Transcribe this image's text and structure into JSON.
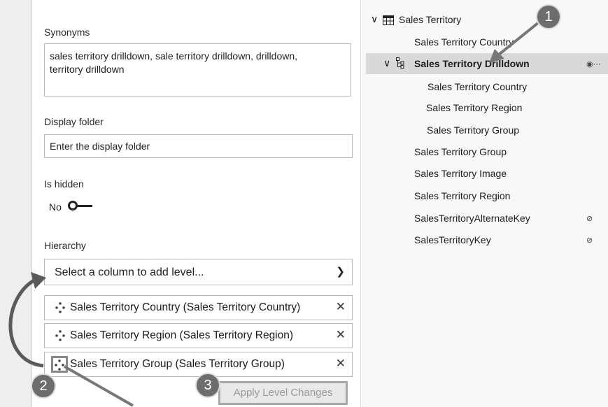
{
  "left": {
    "synonyms_label": "Synonyms",
    "synonyms_line1": "sales territory drilldown, sale territory drilldown, drilldown,",
    "synonyms_line2": "territory drilldown",
    "display_folder_label": "Display folder",
    "display_folder_placeholder": "Enter the display folder",
    "is_hidden_label": "Is hidden",
    "is_hidden_value": "No",
    "hierarchy_label": "Hierarchy",
    "select_placeholder": "Select a column to add level...",
    "levels": [
      {
        "label": "Sales Territory Country (Sales Territory Country)"
      },
      {
        "label": "Sales Territory Region (Sales Territory Region)"
      },
      {
        "label": "Sales Territory Group (Sales Territory Group)"
      }
    ],
    "apply_label": "Apply Level Changes"
  },
  "tree": {
    "table_name": "Sales Territory",
    "items": [
      {
        "label": "Sales Territory Country"
      },
      {
        "label": "Sales Territory Drilldown"
      },
      {
        "label": "Sales Territory Country"
      },
      {
        "label": "Sales Territory Region"
      },
      {
        "label": "Sales Territory Group"
      },
      {
        "label": "Sales Territory Group"
      },
      {
        "label": "Sales Territory Image"
      },
      {
        "label": "Sales Territory Region"
      },
      {
        "label": "SalesTerritoryAlternateKey"
      },
      {
        "label": "SalesTerritoryKey"
      }
    ]
  },
  "callouts": {
    "one": "1",
    "two": "2",
    "three": "3"
  },
  "icons": {
    "table": "table-icon",
    "hierarchy": "hierarchy-icon",
    "drag": "drag-handle-icon",
    "remove": "close-icon",
    "hidden": "eye-hidden-icon",
    "visible": "eye-icon"
  }
}
